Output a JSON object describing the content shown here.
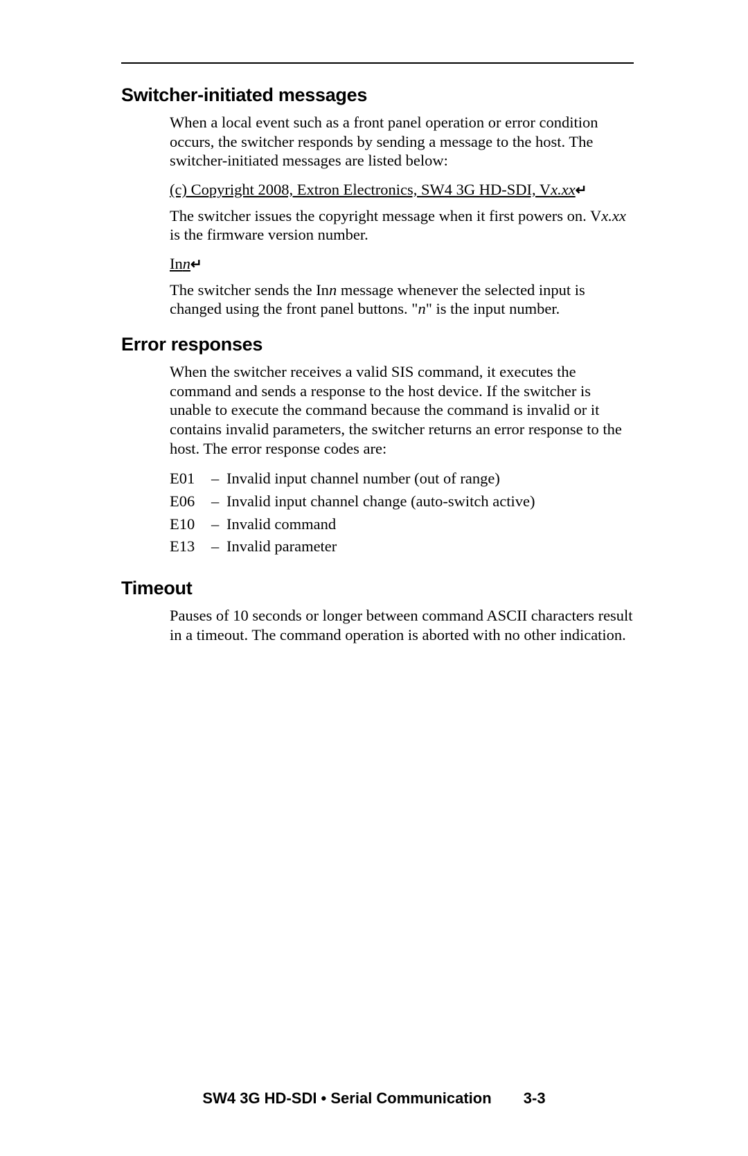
{
  "sections": {
    "switcher": {
      "heading": "Switcher-initiated messages",
      "para1": "When a local event such as a front panel operation or error condition occurs, the switcher responds by sending a message to the host.  The switcher-initiated messages are listed below:",
      "copyright_prefix": "(c) Copyright 2008, Extron Electronics, SW4 3G HD-SDI, V",
      "copyright_var": "x.xx",
      "para2_prefix": "The switcher issues the copyright message when it first powers on.  V",
      "para2_var": "x.xx",
      "para2_suffix": " is the firmware version number.",
      "inn_prefix": "In",
      "inn_var": "n",
      "para3_prefix": "The switcher sends the In",
      "para3_var1": "n",
      "para3_mid": " message whenever the selected input is changed using the front panel buttons.  \"",
      "para3_var2": "n",
      "para3_suffix": "\" is the input number."
    },
    "errors": {
      "heading": "Error responses",
      "para1": "When the switcher receives a valid SIS command, it executes the command and sends a response to the host device.  If the switcher is unable to execute the command because the command is invalid or it contains invalid parameters, the switcher returns an error response to the host.  The error response codes are:",
      "codes": [
        {
          "code": "E01",
          "desc": "Invalid input channel number (out of range)"
        },
        {
          "code": "E06",
          "desc": "Invalid input channel change (auto-switch active)"
        },
        {
          "code": "E10",
          "desc": "Invalid command"
        },
        {
          "code": "E13",
          "desc": "Invalid parameter"
        }
      ]
    },
    "timeout": {
      "heading": "Timeout",
      "para1": "Pauses of 10 seconds or longer between command ASCII characters result in a timeout.  The command operation is aborted with no other indication."
    }
  },
  "footer": {
    "title": "SW4 3G HD-SDI • Serial Communication",
    "page": "3-3"
  }
}
